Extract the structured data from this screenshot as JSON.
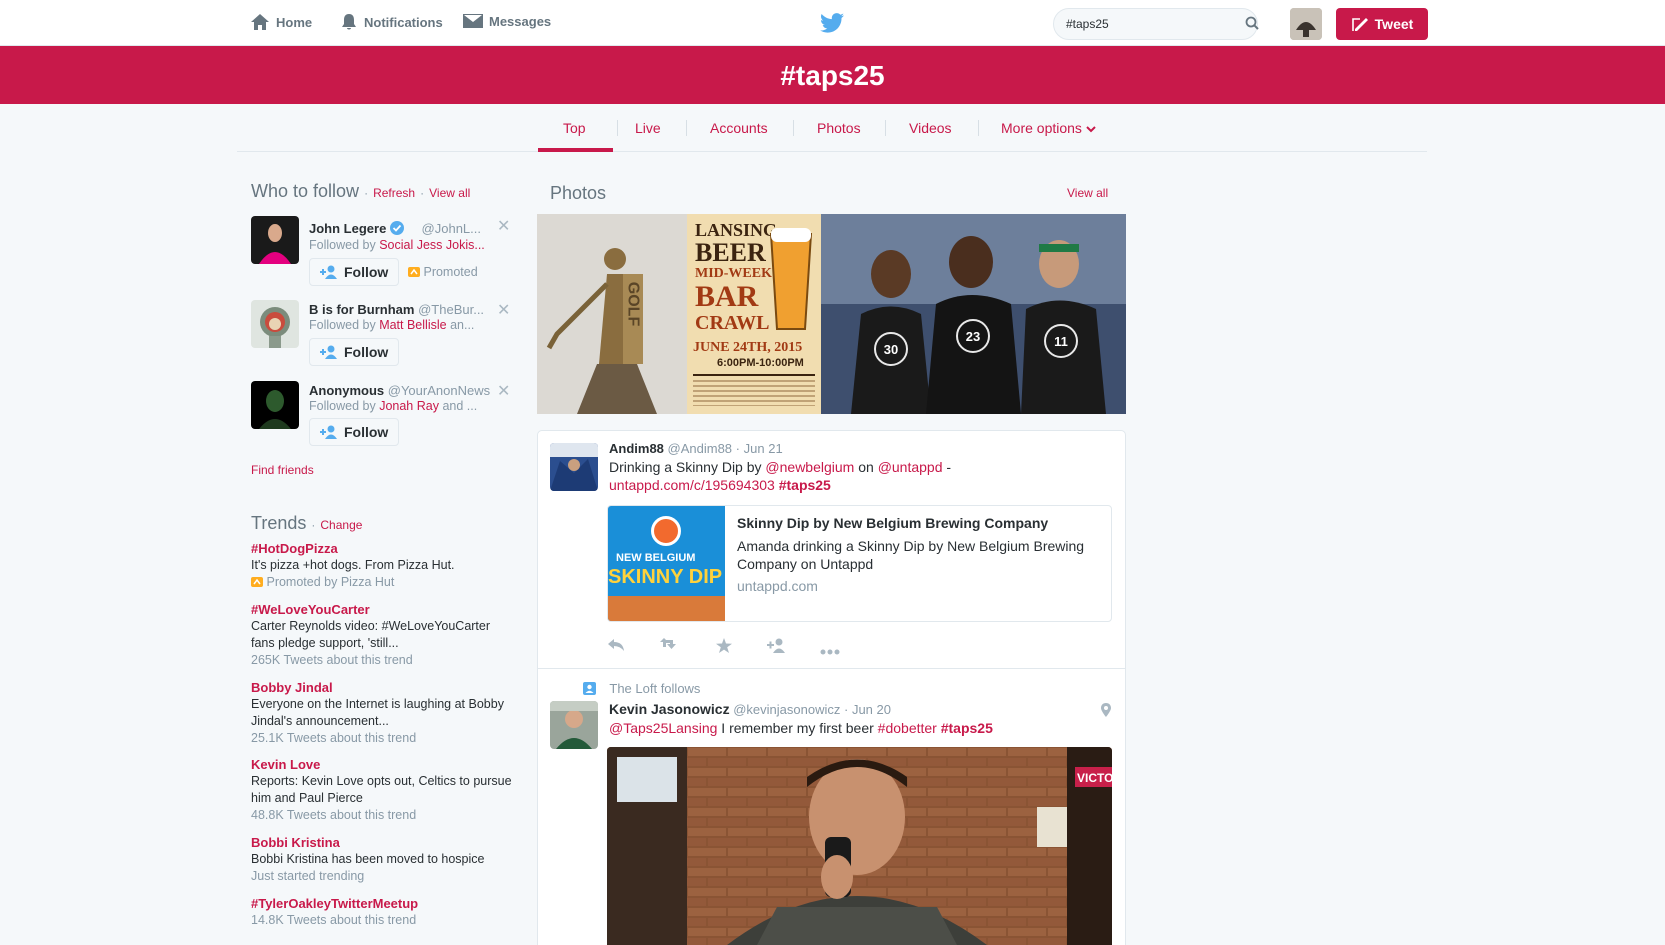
{
  "nav": {
    "home": "Home",
    "notifications": "Notifications",
    "messages": "Messages"
  },
  "search": {
    "value": "#taps25"
  },
  "tweet_button": "Tweet",
  "banner": {
    "title": "#taps25"
  },
  "tabs": [
    "Top",
    "Live",
    "Accounts",
    "Photos",
    "Videos",
    "More options"
  ],
  "who_to_follow": {
    "title": "Who to follow",
    "refresh": "Refresh",
    "dot": "·",
    "view_all": "View all",
    "users": [
      {
        "name": "John Legere",
        "handle": "@JohnL...",
        "followed_by_prefix": "Followed by",
        "followed_by": "Social Jess Jokis...",
        "follow": "Follow",
        "promoted": "Promoted"
      },
      {
        "name": "B is for Burnham",
        "handle": "@TheBur...",
        "followed_by_prefix": "Followed by",
        "followed_by": "Matt Bellisle",
        "followed_by_suffix": "an...",
        "follow": "Follow"
      },
      {
        "name": "Anonymous",
        "handle": "@YourAnonNews",
        "followed_by_prefix": "Followed by",
        "followed_by": "Jonah Ray",
        "followed_by_suffix": "and ...",
        "follow": "Follow"
      }
    ],
    "find_friends": "Find friends"
  },
  "trends": {
    "title": "Trends",
    "change": "Change",
    "items": [
      {
        "name": "#HotDogPizza",
        "desc": "It's pizza +hot dogs. From Pizza Hut.",
        "meta": "Promoted by Pizza Hut"
      },
      {
        "name": "#WeLoveYouCarter",
        "desc": "Carter Reynolds video: #WeLoveYouCarter fans pledge support, 'still...",
        "meta": "265K Tweets about this trend"
      },
      {
        "name": "Bobby Jindal",
        "desc": "Everyone on the Internet is laughing at Bobby Jindal's announcement...",
        "meta": "25.1K Tweets about this trend"
      },
      {
        "name": "Kevin Love",
        "desc": "Reports: Kevin Love opts out, Celtics to pursue him and Paul Pierce",
        "meta": "48.8K Tweets about this trend"
      },
      {
        "name": "Bobbi Kristina",
        "desc": "Bobbi Kristina has been moved to hospice",
        "meta": "Just started trending"
      },
      {
        "name": "#TylerOakleyTwitterMeetup",
        "desc": "",
        "meta": "14.8K Tweets about this trend"
      }
    ]
  },
  "photos": {
    "title": "Photos",
    "view_all": "View all",
    "poster": {
      "line1": "LANSING",
      "line2": "BEER",
      "line3": "MID-WEEK",
      "line4": "BAR",
      "line5": "CRAWL",
      "date": "JUNE 24TH, 2015",
      "time": "6:00PM-10:00PM"
    },
    "golf_text": "GOLF",
    "jerseys": [
      "30",
      "23",
      "11"
    ]
  },
  "tweets": [
    {
      "name": "Andim88",
      "handle": "@Andim88",
      "dot": "·",
      "date": "Jun 21",
      "text_1": "Drinking a Skinny Dip by ",
      "mention_1": "@newbelgium",
      "text_2": " on ",
      "mention_2": "@untappd",
      "text_3": " -",
      "link": "untappd.com/c/195694303",
      "hashtag": "#taps25",
      "card": {
        "title": "Skinny Dip by New Belgium Brewing Company",
        "desc": "Amanda drinking a Skinny Dip by New Belgium Brewing Company on Untappd",
        "domain": "untappd.com",
        "img_line1": "NEW BELGIUM",
        "img_line2": "SKINNY DIP"
      }
    },
    {
      "context": "The Loft follows",
      "name": "Kevin Jasonowicz",
      "handle": "@kevinjasonowicz",
      "dot": "·",
      "date": "Jun 20",
      "mention": "@Taps25Lansing",
      "text": " I remember my first beer ",
      "hashtag_1": "#dobetter",
      "hashtag_2": "#taps25",
      "sign_text": "VICTO"
    }
  ],
  "colors": {
    "brand": "#c8194a",
    "muted": "#8899a6"
  }
}
